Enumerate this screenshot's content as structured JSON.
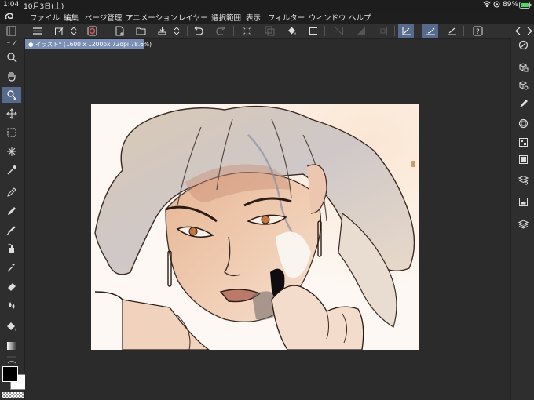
{
  "status_bar": {
    "time": "1:04",
    "date": "10月3日(土)",
    "battery": "89%"
  },
  "menu": {
    "items": [
      "ファイル",
      "編集",
      "ページ管理",
      "アニメーション",
      "レイヤー",
      "選択範囲",
      "表示",
      "フィルター",
      "ウィンドウ",
      "ヘルプ"
    ]
  },
  "document": {
    "tab_title": "イラスト* (1600 x 1200px 72dpi 78.6%)"
  },
  "colors": {
    "accent": "#566a8e",
    "tab": "#7b8fb6",
    "main_color": "#000000",
    "sub_color": "#ffffff"
  },
  "icons": {
    "left_tools": [
      "zoom-icon",
      "hand-icon",
      "select-layer-icon",
      "move-icon",
      "selection-icon",
      "auto-select-icon",
      "eyedropper-icon",
      "pen-icon",
      "pencil-icon",
      "brush-icon",
      "airbrush-icon",
      "decoration-icon",
      "eraser-icon",
      "blend-icon",
      "fill-icon",
      "gradient-icon"
    ],
    "right_panel": [
      "navigator-icon",
      "subtool-icon",
      "tool-property-icon",
      "brush-size-icon",
      "color-wheel-icon",
      "color-set-icon",
      "material-icon",
      "layer-property-icon",
      "layer-search-icon",
      "layer-icon"
    ]
  }
}
